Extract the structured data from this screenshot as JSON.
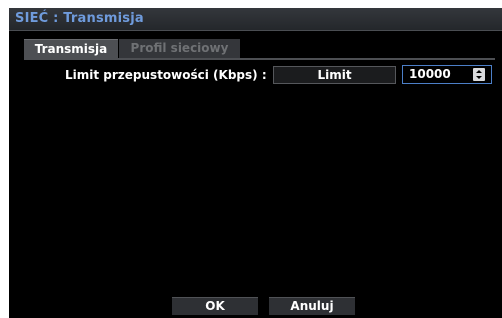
{
  "window": {
    "title": "SIEĆ : Transmisja"
  },
  "tabs": [
    {
      "label": "Transmisja",
      "active": true
    },
    {
      "label": "Profil sieciowy",
      "active": false
    }
  ],
  "bandwidth": {
    "label": "Limit przepustowości (Kbps) :",
    "mode_button": "Limit",
    "value": "10000",
    "stepper_icon": "up-down-arrows-icon"
  },
  "footer": {
    "ok_label": "OK",
    "cancel_label": "Anuluj"
  },
  "colors": {
    "title_text": "#6f9bdc",
    "background": "#000000",
    "tab_active": "#4d4f53",
    "tab_inactive_text": "#6f7174",
    "stepper_border": "#4c7fc8"
  }
}
